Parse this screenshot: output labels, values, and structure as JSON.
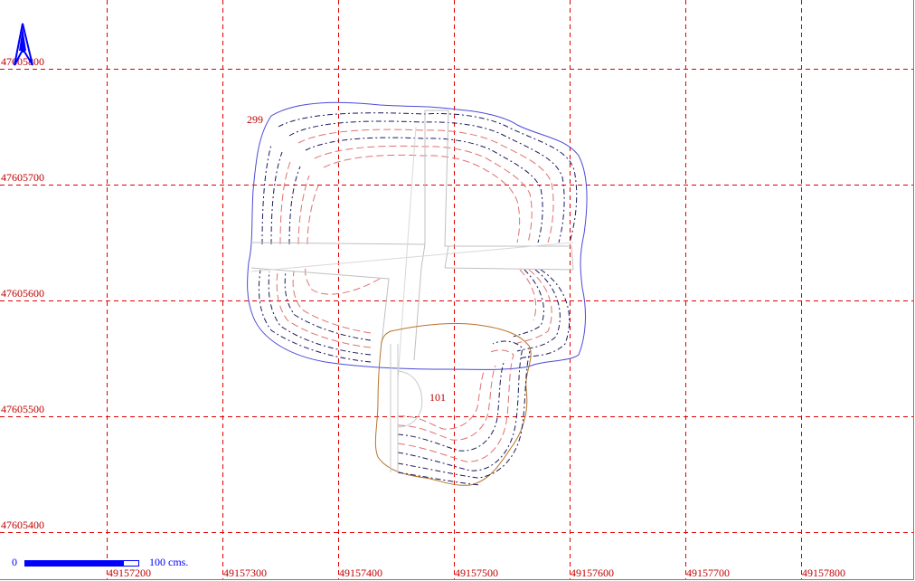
{
  "map": {
    "x_ticks": [
      "49157200",
      "49157300",
      "49157400",
      "49157500",
      "49157600",
      "49157700",
      "49157800"
    ],
    "y_ticks": [
      "47605800",
      "47605700",
      "47605600",
      "47605500",
      "47605400"
    ],
    "parcel_labels": [
      "299",
      "101"
    ],
    "north_arrow": "north-arrow-icon",
    "scale": {
      "start": "0",
      "end": "100 cms."
    },
    "colors": {
      "grid": "#e00000",
      "label": "#c00000",
      "boundary_large": "#4a4ad8",
      "boundary_small": "#b8732b",
      "contour_dark": "#1a1a5e",
      "contour_red": "#e07070",
      "road": "#c8c8c8"
    }
  }
}
